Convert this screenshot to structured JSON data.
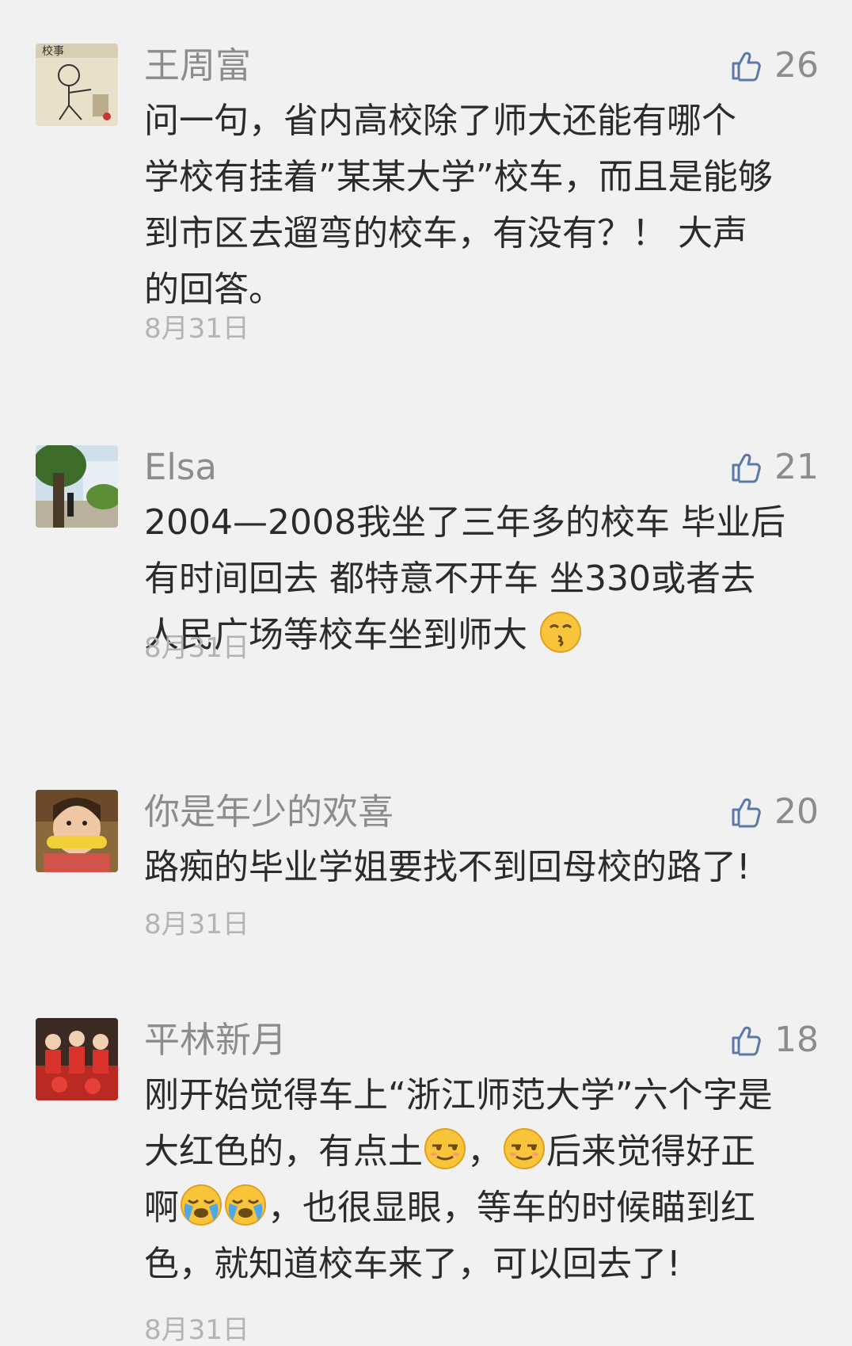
{
  "colors": {
    "background": "#f1f1f1",
    "name_text": "#8c8c8c",
    "body_text": "#2b2b2b",
    "date_text": "#b3b3b3",
    "like_icon": "#5a78a8"
  },
  "comments": [
    {
      "name": "王周富",
      "likes": "26",
      "lines": [
        "问一句，省内高校除了师大还能有哪个",
        "学校有挂着”某某大学”校车，而且是能够",
        "到市区去遛弯的校车，有没有？！ 大声",
        "的回答。"
      ],
      "date": "8月31日",
      "avatar_icon": "cartoon-sketch-avatar"
    },
    {
      "name": "Elsa",
      "likes": "21",
      "lines": [
        "2004—2008我坐了三年多的校车 毕业后",
        "有时间回去 都特意不开车 坐330或者去",
        "人民广场等校车坐到师大"
      ],
      "emoji": "kissing-face-emoji",
      "date": "8月31日",
      "avatar_icon": "tree-photo-avatar"
    },
    {
      "name": "你是年少的欢喜",
      "likes": "20",
      "lines": [
        "路痴的毕业学姐要找不到回母校的路了!"
      ],
      "date": "8月31日",
      "avatar_icon": "child-eating-corn-avatar"
    },
    {
      "name": "平林新月",
      "likes": "18",
      "line1": "刚开始觉得车上“浙江师范大学”六个字是",
      "line2_a": "大红色的，有点土",
      "line2_b": "，",
      "line2_c": "后来觉得好正",
      "line3_a": "啊",
      "line3_b": "，也很显眼，等车的时候瞄到红",
      "line4": "色，就知道校车来了，可以回去了!",
      "date": "8月31日",
      "avatar_icon": "red-figures-avatar"
    }
  ]
}
